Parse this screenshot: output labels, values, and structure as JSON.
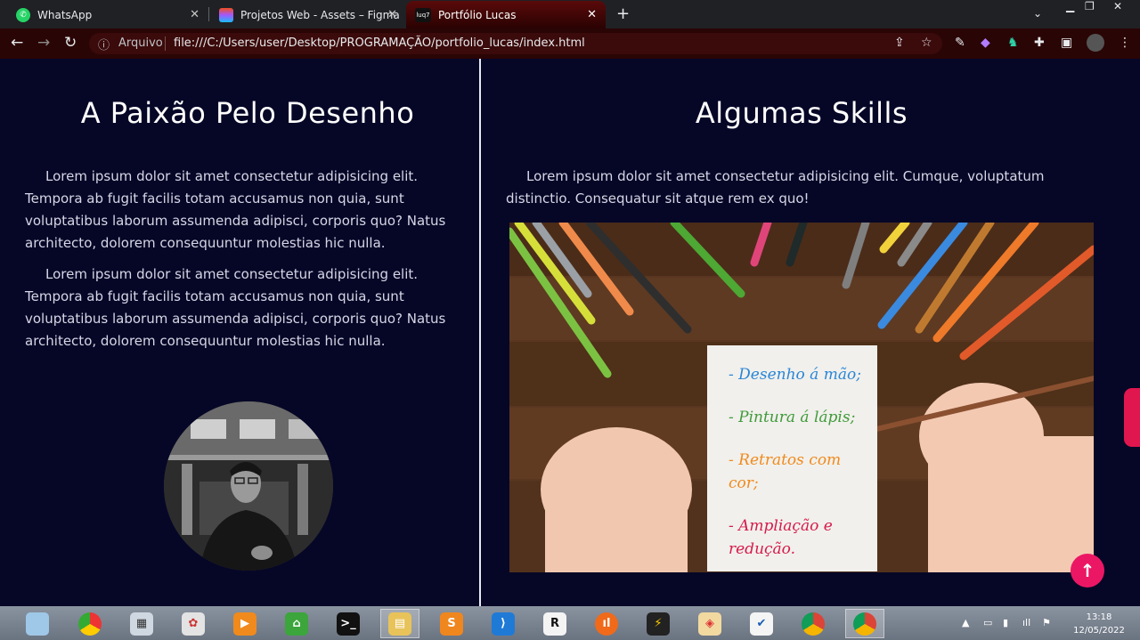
{
  "browser": {
    "tabs": [
      {
        "title": "WhatsApp",
        "active": false
      },
      {
        "title": "Projetos Web - Assets – Figma",
        "active": false
      },
      {
        "title": "Portfólio Lucas",
        "active": true
      }
    ],
    "address": {
      "security_label": "Arquivo",
      "url": "file:///C:/Users/user/Desktop/PROGRAMAÇÃO/portfolio_lucas/index.html"
    },
    "favicon_active": "luq7",
    "accent": "#5a0a0a"
  },
  "left_section": {
    "title": "A Paixão Pelo Desenho",
    "paragraphs": [
      "Lorem ipsum dolor sit amet consectetur adipisicing elit. Tempora ab fugit facilis totam accusamus non quia, sunt voluptatibus laborum assumenda adipisci, corporis quo? Natus architecto, dolorem consequuntur molestias hic nulla.",
      "Lorem ipsum dolor sit amet consectetur adipisicing elit. Tempora ab fugit facilis totam accusamus non quia, sunt voluptatibus laborum assumenda adipisci, corporis quo? Natus architecto, dolorem consequuntur molestias hic nulla."
    ]
  },
  "right_section": {
    "title": "Algumas Skills",
    "paragraph": "Lorem ipsum dolor sit amet consectetur adipisicing elit. Cumque, voluptatum distinctio. Consequatur sit atque rem ex quo!",
    "skills": [
      {
        "text": "- Desenho á mão;",
        "color": "#2a86d6"
      },
      {
        "text": "- Pintura á lápis;",
        "color": "#3f9a3a"
      },
      {
        "text": "- Retratos com cor;",
        "color": "#f08a1c"
      },
      {
        "text": "- Ampliação e redução.",
        "color": "#d61a4a"
      }
    ]
  },
  "scroll_top_icon": "arrow-up-icon",
  "page_accent": "#ec1764",
  "taskbar": {
    "time": "13:18",
    "date": "12/05/2022"
  }
}
